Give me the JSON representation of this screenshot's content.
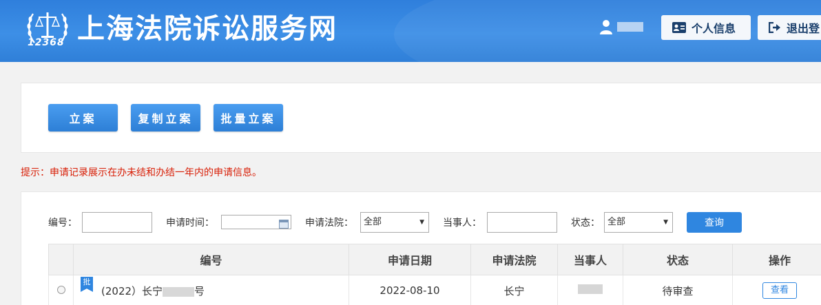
{
  "header": {
    "logo_number": "12368",
    "site_title": "上海法院诉讼服务网",
    "profile_button": "个人信息",
    "logout_button": "退出登"
  },
  "actions": {
    "file_case": "立案",
    "copy_case": "复制立案",
    "batch_case": "批量立案"
  },
  "tip": "提示：申请记录展示在办未结和办结一年内的申请信息。",
  "search": {
    "number_label": "编号：",
    "number_value": "",
    "date_label": "申请时间：",
    "date_value": "",
    "court_label": "申请法院：",
    "court_value": "全部",
    "party_label": "当事人：",
    "party_value": "",
    "status_label": "状态：",
    "status_value": "全部",
    "query_button": "查询"
  },
  "table": {
    "columns": [
      "编号",
      "申请日期",
      "申请法院",
      "当事人",
      "状态",
      "操作"
    ],
    "rows": [
      {
        "batch_tag": "批",
        "id_prefix": "(2022）长宁",
        "id_suffix": "号",
        "date": "2022-08-10",
        "court": "长宁",
        "status": "待审查",
        "action": "查看"
      }
    ]
  },
  "colors": {
    "header_blue": "#2f7fdc",
    "button_blue": "#2f86e0",
    "tip_red": "#d81e06"
  }
}
